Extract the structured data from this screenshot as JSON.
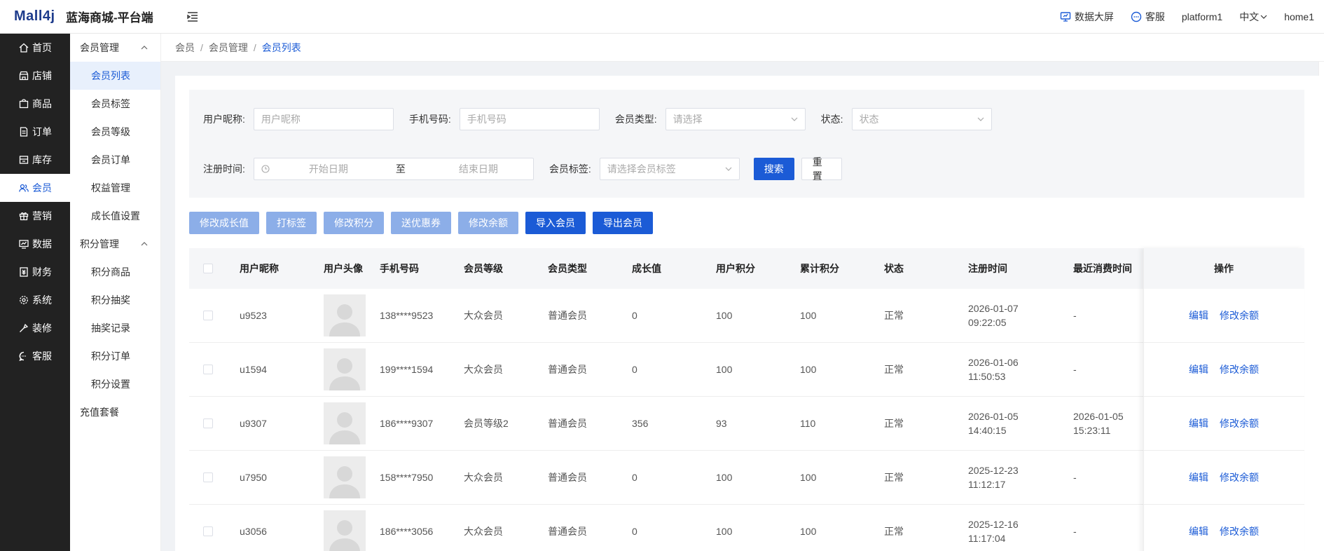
{
  "header": {
    "logo": "Mall4j",
    "site_name": "蓝海商城-平台端",
    "data_screen": "数据大屏",
    "service": "客服",
    "platform": "platform1",
    "language": "中文",
    "user": "home1"
  },
  "sidebar": {
    "items": [
      {
        "label": "首页",
        "icon": "home-icon"
      },
      {
        "label": "店铺",
        "icon": "shop-icon"
      },
      {
        "label": "商品",
        "icon": "goods-icon"
      },
      {
        "label": "订单",
        "icon": "order-icon"
      },
      {
        "label": "库存",
        "icon": "stock-icon"
      },
      {
        "label": "会员",
        "icon": "member-icon"
      },
      {
        "label": "营销",
        "icon": "gift-icon"
      },
      {
        "label": "数据",
        "icon": "chart-icon"
      },
      {
        "label": "财务",
        "icon": "finance-icon"
      },
      {
        "label": "系统",
        "icon": "settings-icon"
      },
      {
        "label": "装修",
        "icon": "decorate-icon"
      },
      {
        "label": "客服",
        "icon": "chat-icon"
      }
    ],
    "active": "会员"
  },
  "submenu": {
    "group1": "会员管理",
    "group1_items": [
      "会员列表",
      "会员标签",
      "会员等级",
      "会员订单",
      "权益管理",
      "成长值设置"
    ],
    "group2": "积分管理",
    "group2_items": [
      "积分商品",
      "积分抽奖",
      "抽奖记录",
      "积分订单",
      "积分设置"
    ],
    "group3": "充值套餐"
  },
  "breadcrumb": [
    "会员",
    "会员管理",
    "会员列表"
  ],
  "search": {
    "nickname_label": "用户昵称:",
    "nickname_placeholder": "用户昵称",
    "phone_label": "手机号码:",
    "phone_placeholder": "手机号码",
    "type_label": "会员类型:",
    "type_placeholder": "请选择",
    "status_label": "状态:",
    "status_placeholder": "状态",
    "reg_label": "注册时间:",
    "start_placeholder": "开始日期",
    "range_sep": "至",
    "end_placeholder": "结束日期",
    "tag_label": "会员标签:",
    "tag_placeholder": "请选择会员标签",
    "search_btn": "搜索",
    "reset_btn": "重置"
  },
  "actions": [
    "修改成长值",
    "打标签",
    "修改积分",
    "送优惠券",
    "修改余额",
    "导入会员",
    "导出会员"
  ],
  "table": {
    "headers": [
      "用户昵称",
      "用户头像",
      "手机号码",
      "会员等级",
      "会员类型",
      "成长值",
      "用户积分",
      "累计积分",
      "状态",
      "注册时间",
      "最近消费时间",
      "操作"
    ],
    "rows": [
      {
        "nick": "u9523",
        "phone": "138****9523",
        "level": "大众会员",
        "type": "普通会员",
        "growth": "0",
        "score": "100",
        "total": "100",
        "status": "正常",
        "reg_date": "2026-01-07",
        "reg_time": "09:22:05",
        "last_date": "-",
        "last_time": ""
      },
      {
        "nick": "u1594",
        "phone": "199****1594",
        "level": "大众会员",
        "type": "普通会员",
        "growth": "0",
        "score": "100",
        "total": "100",
        "status": "正常",
        "reg_date": "2026-01-06",
        "reg_time": "11:50:53",
        "last_date": "-",
        "last_time": ""
      },
      {
        "nick": "u9307",
        "phone": "186****9307",
        "level": "会员等级2",
        "type": "普通会员",
        "growth": "356",
        "score": "93",
        "total": "110",
        "status": "正常",
        "reg_date": "2026-01-05",
        "reg_time": "14:40:15",
        "last_date": "2026-01-05",
        "last_time": "15:23:11"
      },
      {
        "nick": "u7950",
        "phone": "158****7950",
        "level": "大众会员",
        "type": "普通会员",
        "growth": "0",
        "score": "100",
        "total": "100",
        "status": "正常",
        "reg_date": "2025-12-23",
        "reg_time": "11:12:17",
        "last_date": "-",
        "last_time": ""
      },
      {
        "nick": "u3056",
        "phone": "186****3056",
        "level": "大众会员",
        "type": "普通会员",
        "growth": "0",
        "score": "100",
        "total": "100",
        "status": "正常",
        "reg_date": "2025-12-16",
        "reg_time": "11:17:04",
        "last_date": "-",
        "last_time": ""
      }
    ],
    "op_edit": "编辑",
    "op_balance": "修改余额"
  },
  "colors": {
    "primary": "#1b5bd6",
    "primary_light": "#8caee8",
    "sidebar_bg": "#222222"
  }
}
